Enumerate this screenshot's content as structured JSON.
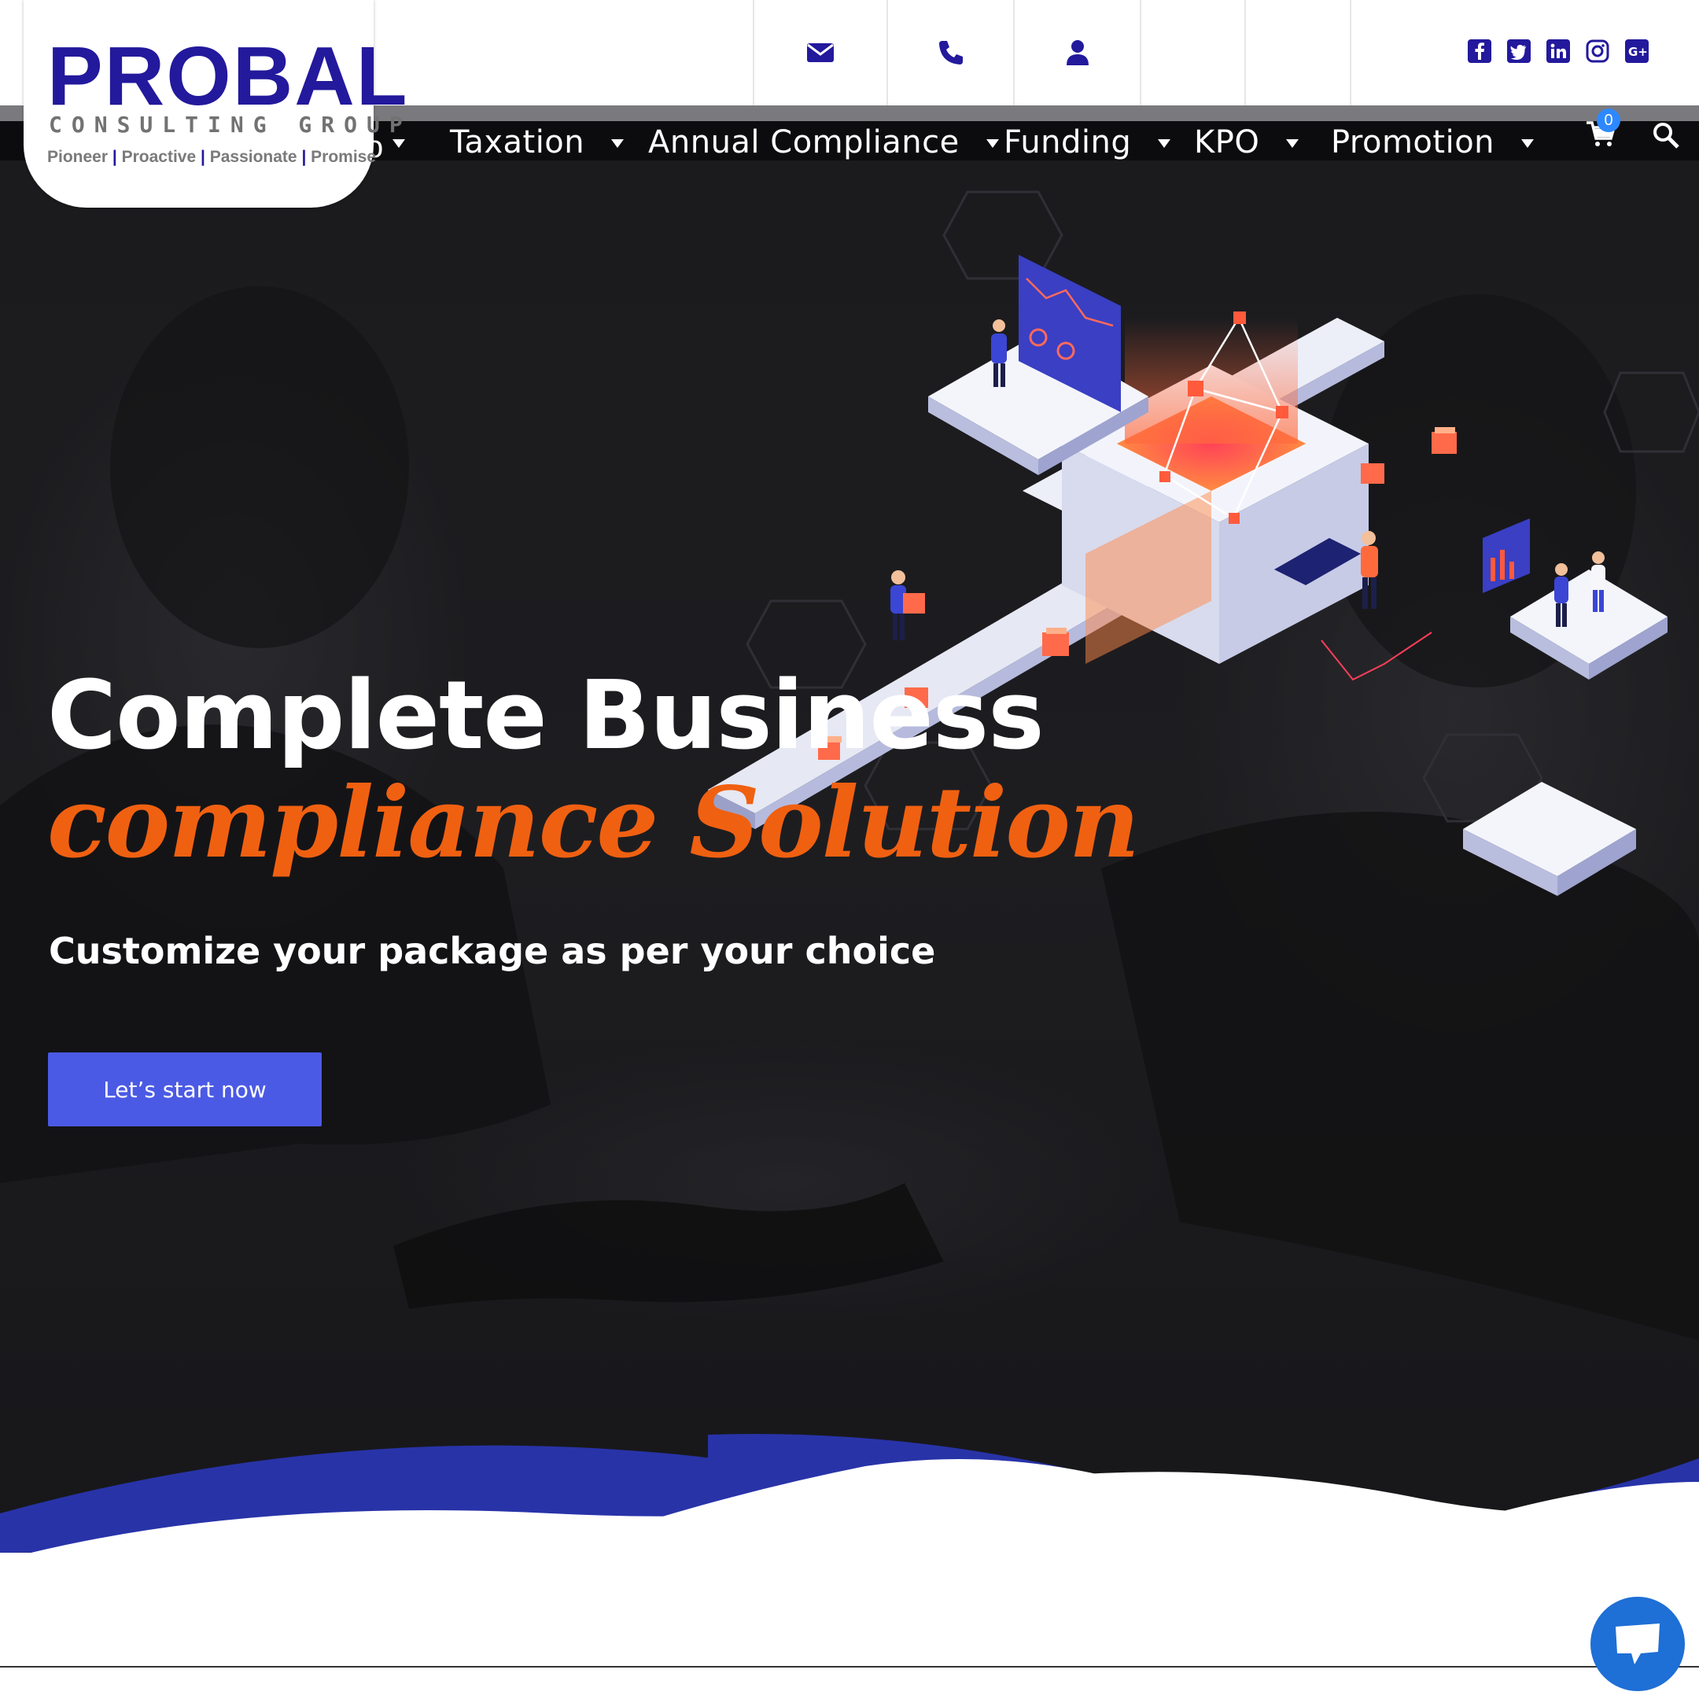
{
  "brand": {
    "name": "PROBAL",
    "subtitle": "CONSULTING GROUP",
    "tagline": [
      "Pioneer",
      "Proactive",
      "Passionate",
      "Promise"
    ],
    "primary_color": "#23199c",
    "accent_color": "#f06011"
  },
  "topbar": {
    "icons": [
      "envelope-icon",
      "phone-icon",
      "user-icon"
    ],
    "social": [
      "facebook-icon",
      "twitter-icon",
      "linkedin-icon",
      "instagram-icon",
      "google-plus-icon"
    ]
  },
  "nav": {
    "partial_label": "o",
    "items": [
      {
        "label": "Taxation"
      },
      {
        "label": "Annual Compliance"
      },
      {
        "label": "Funding"
      },
      {
        "label": "KPO"
      },
      {
        "label": "Promotion"
      }
    ],
    "cart_count": "0"
  },
  "hero": {
    "title": "Complete Business",
    "accent": "compliance Solution",
    "subtitle": "Customize your package as per your choice",
    "cta_label": "Let’s start now",
    "cta_color": "#4b5ae4"
  }
}
